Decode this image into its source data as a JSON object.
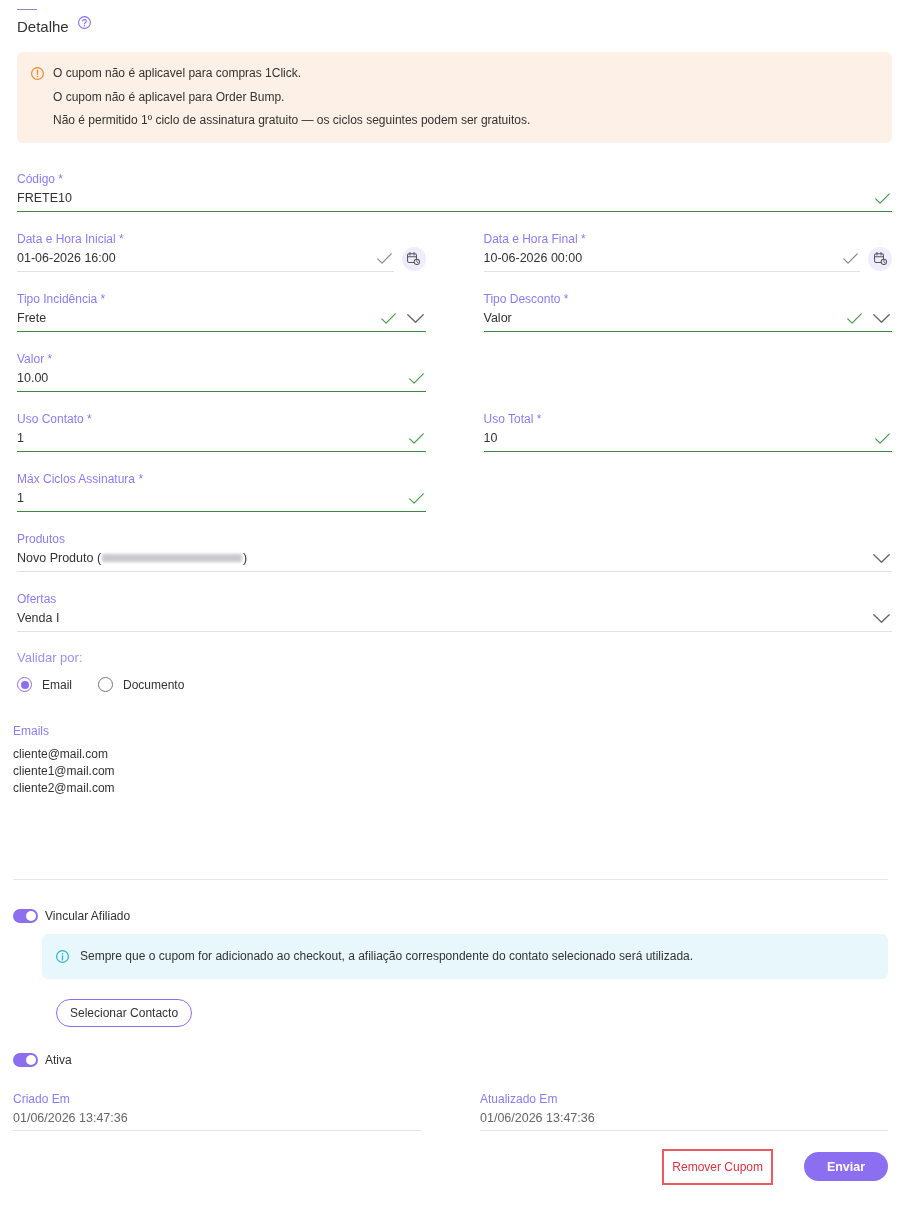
{
  "header": {
    "title": "Detalhe"
  },
  "warning": {
    "lines": [
      "O cupom não é aplicavel para compras 1Click.",
      "O cupom não é aplicavel para Order Bump.",
      "Não é permitido 1º ciclo de assinatura gratuito — os ciclos seguintes podem ser gratuitos."
    ]
  },
  "form": {
    "rows": [
      [
        {
          "kind": "text",
          "label": "Código *",
          "value": "FRETE10",
          "valid": true,
          "wide": true
        }
      ],
      [
        {
          "kind": "date",
          "label": "Data e Hora Inicial *",
          "value": "01-06-2026 16:00"
        },
        {
          "kind": "date",
          "label": "Data e Hora Final *",
          "value": "10-06-2026 00:00"
        }
      ],
      [
        {
          "kind": "select",
          "label": "Tipo Incidência *",
          "value": "Frete",
          "valid": true
        },
        {
          "kind": "select",
          "label": "Tipo Desconto *",
          "value": "Valor",
          "valid": true
        }
      ],
      [
        {
          "kind": "text",
          "label": "Valor *",
          "value": "10.00",
          "valid": true
        }
      ],
      [
        {
          "kind": "text",
          "label": "Uso Contato *",
          "value": "1",
          "valid": true
        },
        {
          "kind": "text",
          "label": "Uso Total *",
          "value": "10",
          "valid": true
        }
      ],
      [
        {
          "kind": "text",
          "label": "Máx Ciclos Assinatura *",
          "value": "1",
          "valid": true
        }
      ],
      [
        {
          "kind": "select",
          "label": "Produtos",
          "value": "Novo Produto (",
          "redacted": true,
          "value_suffix": ")",
          "valid": false,
          "wide": true
        }
      ],
      [
        {
          "kind": "select",
          "label": "Ofertas",
          "value": "Venda I",
          "valid": false,
          "wide": true
        }
      ]
    ]
  },
  "validation": {
    "label": "Validar por:",
    "options": [
      {
        "label": "Email",
        "selected": true
      },
      {
        "label": "Documento",
        "selected": false
      }
    ]
  },
  "emails": {
    "label": "Emails",
    "values": [
      "cliente@mail.com",
      "cliente1@mail.com",
      "cliente2@mail.com"
    ]
  },
  "affiliate": {
    "label": "Vincular Afiliado",
    "on": true,
    "info": "Sempre que o cupom for adicionado ao checkout, a afiliação correspondente do contato selecionado será utilizada.",
    "button": "Selecionar Contacto"
  },
  "active": {
    "label": "Ativa",
    "on": true
  },
  "timestamps": [
    {
      "label": "Criado Em",
      "value": "01/06/2026 13:47:36"
    },
    {
      "label": "Atualizado Em",
      "value": "01/06/2026 13:47:36"
    }
  ],
  "actions": [
    {
      "kind": "danger",
      "label": "Remover Cupom",
      "highlighted": true
    },
    {
      "kind": "primary",
      "label": "Enviar"
    }
  ]
}
